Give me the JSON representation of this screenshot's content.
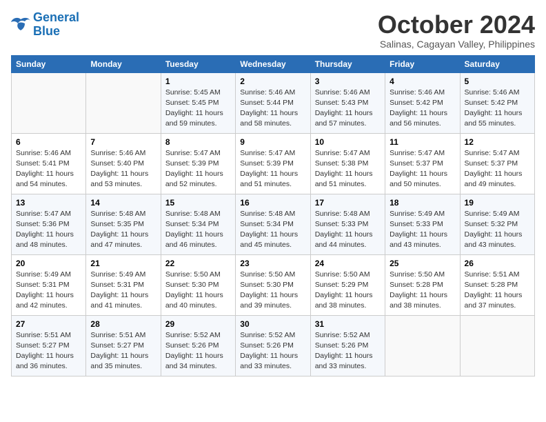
{
  "logo": {
    "line1": "General",
    "line2": "Blue"
  },
  "title": "October 2024",
  "subtitle": "Salinas, Cagayan Valley, Philippines",
  "days_header": [
    "Sunday",
    "Monday",
    "Tuesday",
    "Wednesday",
    "Thursday",
    "Friday",
    "Saturday"
  ],
  "weeks": [
    [
      {
        "day": "",
        "info": ""
      },
      {
        "day": "",
        "info": ""
      },
      {
        "day": "1",
        "info": "Sunrise: 5:45 AM\nSunset: 5:45 PM\nDaylight: 11 hours and 59 minutes."
      },
      {
        "day": "2",
        "info": "Sunrise: 5:46 AM\nSunset: 5:44 PM\nDaylight: 11 hours and 58 minutes."
      },
      {
        "day": "3",
        "info": "Sunrise: 5:46 AM\nSunset: 5:43 PM\nDaylight: 11 hours and 57 minutes."
      },
      {
        "day": "4",
        "info": "Sunrise: 5:46 AM\nSunset: 5:42 PM\nDaylight: 11 hours and 56 minutes."
      },
      {
        "day": "5",
        "info": "Sunrise: 5:46 AM\nSunset: 5:42 PM\nDaylight: 11 hours and 55 minutes."
      }
    ],
    [
      {
        "day": "6",
        "info": "Sunrise: 5:46 AM\nSunset: 5:41 PM\nDaylight: 11 hours and 54 minutes."
      },
      {
        "day": "7",
        "info": "Sunrise: 5:46 AM\nSunset: 5:40 PM\nDaylight: 11 hours and 53 minutes."
      },
      {
        "day": "8",
        "info": "Sunrise: 5:47 AM\nSunset: 5:39 PM\nDaylight: 11 hours and 52 minutes."
      },
      {
        "day": "9",
        "info": "Sunrise: 5:47 AM\nSunset: 5:39 PM\nDaylight: 11 hours and 51 minutes."
      },
      {
        "day": "10",
        "info": "Sunrise: 5:47 AM\nSunset: 5:38 PM\nDaylight: 11 hours and 51 minutes."
      },
      {
        "day": "11",
        "info": "Sunrise: 5:47 AM\nSunset: 5:37 PM\nDaylight: 11 hours and 50 minutes."
      },
      {
        "day": "12",
        "info": "Sunrise: 5:47 AM\nSunset: 5:37 PM\nDaylight: 11 hours and 49 minutes."
      }
    ],
    [
      {
        "day": "13",
        "info": "Sunrise: 5:47 AM\nSunset: 5:36 PM\nDaylight: 11 hours and 48 minutes."
      },
      {
        "day": "14",
        "info": "Sunrise: 5:48 AM\nSunset: 5:35 PM\nDaylight: 11 hours and 47 minutes."
      },
      {
        "day": "15",
        "info": "Sunrise: 5:48 AM\nSunset: 5:34 PM\nDaylight: 11 hours and 46 minutes."
      },
      {
        "day": "16",
        "info": "Sunrise: 5:48 AM\nSunset: 5:34 PM\nDaylight: 11 hours and 45 minutes."
      },
      {
        "day": "17",
        "info": "Sunrise: 5:48 AM\nSunset: 5:33 PM\nDaylight: 11 hours and 44 minutes."
      },
      {
        "day": "18",
        "info": "Sunrise: 5:49 AM\nSunset: 5:33 PM\nDaylight: 11 hours and 43 minutes."
      },
      {
        "day": "19",
        "info": "Sunrise: 5:49 AM\nSunset: 5:32 PM\nDaylight: 11 hours and 43 minutes."
      }
    ],
    [
      {
        "day": "20",
        "info": "Sunrise: 5:49 AM\nSunset: 5:31 PM\nDaylight: 11 hours and 42 minutes."
      },
      {
        "day": "21",
        "info": "Sunrise: 5:49 AM\nSunset: 5:31 PM\nDaylight: 11 hours and 41 minutes."
      },
      {
        "day": "22",
        "info": "Sunrise: 5:50 AM\nSunset: 5:30 PM\nDaylight: 11 hours and 40 minutes."
      },
      {
        "day": "23",
        "info": "Sunrise: 5:50 AM\nSunset: 5:30 PM\nDaylight: 11 hours and 39 minutes."
      },
      {
        "day": "24",
        "info": "Sunrise: 5:50 AM\nSunset: 5:29 PM\nDaylight: 11 hours and 38 minutes."
      },
      {
        "day": "25",
        "info": "Sunrise: 5:50 AM\nSunset: 5:28 PM\nDaylight: 11 hours and 38 minutes."
      },
      {
        "day": "26",
        "info": "Sunrise: 5:51 AM\nSunset: 5:28 PM\nDaylight: 11 hours and 37 minutes."
      }
    ],
    [
      {
        "day": "27",
        "info": "Sunrise: 5:51 AM\nSunset: 5:27 PM\nDaylight: 11 hours and 36 minutes."
      },
      {
        "day": "28",
        "info": "Sunrise: 5:51 AM\nSunset: 5:27 PM\nDaylight: 11 hours and 35 minutes."
      },
      {
        "day": "29",
        "info": "Sunrise: 5:52 AM\nSunset: 5:26 PM\nDaylight: 11 hours and 34 minutes."
      },
      {
        "day": "30",
        "info": "Sunrise: 5:52 AM\nSunset: 5:26 PM\nDaylight: 11 hours and 33 minutes."
      },
      {
        "day": "31",
        "info": "Sunrise: 5:52 AM\nSunset: 5:26 PM\nDaylight: 11 hours and 33 minutes."
      },
      {
        "day": "",
        "info": ""
      },
      {
        "day": "",
        "info": ""
      }
    ]
  ]
}
